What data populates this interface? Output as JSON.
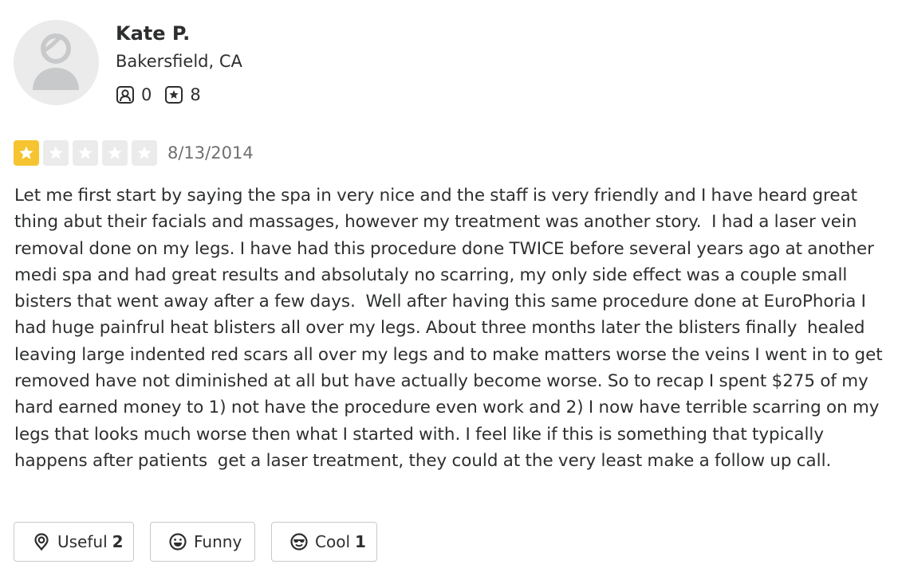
{
  "user": {
    "name": "Kate P.",
    "location": "Bakersfield, CA",
    "friends_count": "0",
    "reviews_count": "8",
    "avatar_icon": "default-user-avatar-icon",
    "friends_icon": "friends-icon",
    "reviews_icon": "reviews-star-icon"
  },
  "review": {
    "rating": 1,
    "rating_max": 5,
    "date": "8/13/2014",
    "text": "Let me first start by saying the spa in very nice and the staff is very friendly and I have heard great thing abut their facials and massages, however my treatment was another story.  I had a laser vein removal done on my legs. I have had this procedure done TWICE before several years ago at another medi spa and had great results and absolutaly no scarring, my only side effect was a couple small bisters that went away after a few days.  Well after having this same procedure done at EuroPhoria I had huge painfrul heat blisters all over my legs. About three months later the blisters finally  healed leaving large indented red scars all over my legs and to make matters worse the veins I went in to get removed have not diminished at all but have actually become worse. So to recap I spent $275 of my hard earned money to 1) not have the procedure even work and 2) I now have terrible scarring on my legs that looks much worse then what I started with. I feel like if this is something that typically happens after patients  get a laser treatment, they could at the very least make a follow up call."
  },
  "reactions": {
    "useful": {
      "label": "Useful",
      "count": "2",
      "icon": "lightbulb-icon"
    },
    "funny": {
      "label": "Funny",
      "count": "",
      "icon": "laughing-face-icon"
    },
    "cool": {
      "label": "Cool",
      "count": "1",
      "icon": "sunglasses-face-icon"
    }
  },
  "colors": {
    "star_filled": "#f5c430",
    "star_empty": "#ebebeb",
    "text": "#2d2e2f",
    "date": "#6e7072",
    "border": "#c8c9ca",
    "avatar_bg": "#ebebeb",
    "avatar_fg": "#c8c9ca"
  }
}
